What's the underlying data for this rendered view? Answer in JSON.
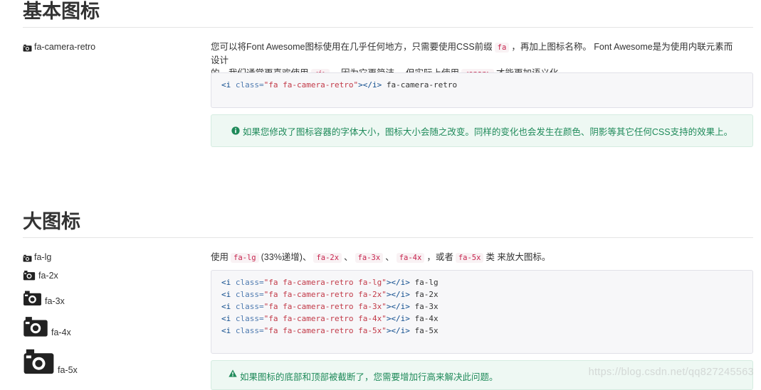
{
  "basic": {
    "title": "基本图标",
    "icon_label": "fa-camera-retro",
    "desc_line1_a": "您可以将Font Awesome图标使用在几乎任何地方，只需要使用CSS前缀",
    "desc_line1_code": "fa",
    "desc_line1_b": "，再加上图标名称。 Font Awesome是为使用内联元素而设计",
    "desc_line2_a": "的。我们通常更喜欢使用",
    "desc_line2_code1": "<i>",
    "desc_line2_b": "，因为它更简洁。 但实际上使用",
    "desc_line2_code2": "<span>",
    "desc_line2_c": "才能更加语义化。",
    "code": {
      "open": "<i ",
      "attr": "class=",
      "value": "\"fa fa-camera-retro\"",
      "close": "></i>",
      "label": " fa-camera-retro"
    },
    "alert_text": "如果您修改了图标容器的字体大小，图标大小会随之改变。同样的变化也会发生在颜色、阴影等其它任何CSS支持的效果上。",
    "alert_icon": "info-circle-icon"
  },
  "large": {
    "title": "大图标",
    "items": [
      {
        "label": "fa-lg"
      },
      {
        "label": "fa-2x"
      },
      {
        "label": "fa-3x"
      },
      {
        "label": "fa-4x"
      },
      {
        "label": "fa-5x"
      }
    ],
    "desc_a": "使用",
    "desc_c1": "fa-lg",
    "desc_t1": "(33%递增)、",
    "desc_c2": "fa-2x",
    "desc_t2": "、",
    "desc_c3": "fa-3x",
    "desc_t3": "、",
    "desc_c4": "fa-4x",
    "desc_t4": "，或者",
    "desc_c5": "fa-5x",
    "desc_t5": "类 来放大图标。",
    "code_lines": [
      {
        "open": "<i ",
        "attr": "class=",
        "value": "\"fa fa-camera-retro fa-lg\"",
        "close": "></i>",
        "label": " fa-lg"
      },
      {
        "open": "<i ",
        "attr": "class=",
        "value": "\"fa fa-camera-retro fa-2x\"",
        "close": "></i>",
        "label": " fa-2x"
      },
      {
        "open": "<i ",
        "attr": "class=",
        "value": "\"fa fa-camera-retro fa-3x\"",
        "close": "></i>",
        "label": " fa-3x"
      },
      {
        "open": "<i ",
        "attr": "class=",
        "value": "\"fa fa-camera-retro fa-4x\"",
        "close": "></i>",
        "label": " fa-4x"
      },
      {
        "open": "<i ",
        "attr": "class=",
        "value": "\"fa fa-camera-retro fa-5x\"",
        "close": "></i>",
        "label": " fa-5x"
      }
    ],
    "alert_text": "如果图标的底部和顶部被截断了，您需要增加行高来解决此问题。",
    "alert_icon": "warning-triangle-icon"
  },
  "watermark": "https://blog.csdn.net/qq827245563",
  "colors": {
    "alert_text": "#1f8a5a",
    "alert_bg": "#eef8f3",
    "inline_code": "#c7254e",
    "code_bg": "#f7f7f9"
  }
}
